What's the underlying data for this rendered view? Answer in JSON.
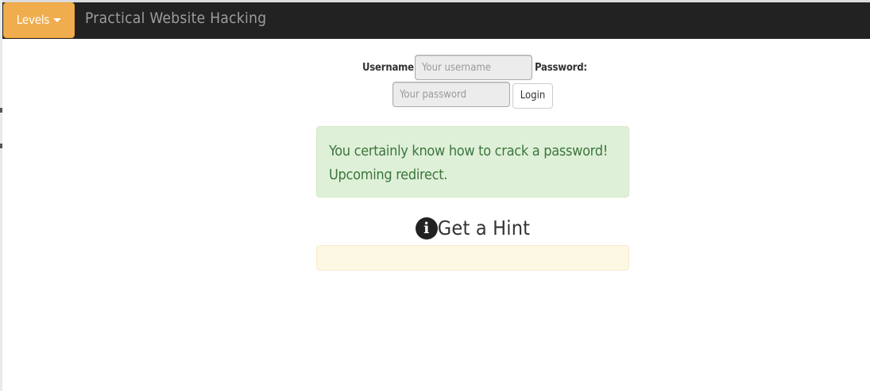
{
  "navbar": {
    "levels_label": "Levels",
    "brand": "Practical Website Hacking"
  },
  "login": {
    "username_label": "Username:",
    "username_placeholder": "Your username",
    "password_label": "Password:",
    "password_placeholder": "Your password",
    "login_label": "Login"
  },
  "alert": {
    "message": "You certainly know how to crack a password! Upcoming redirect."
  },
  "hint": {
    "icon": "info-circle-icon",
    "title": "Get a Hint",
    "content": ""
  },
  "colors": {
    "navbar": "#222222",
    "levels_button": "#f0ad4e",
    "success_bg": "#dff0d8",
    "success_text": "#3c763d",
    "warning_bg": "#fcf8e3"
  }
}
